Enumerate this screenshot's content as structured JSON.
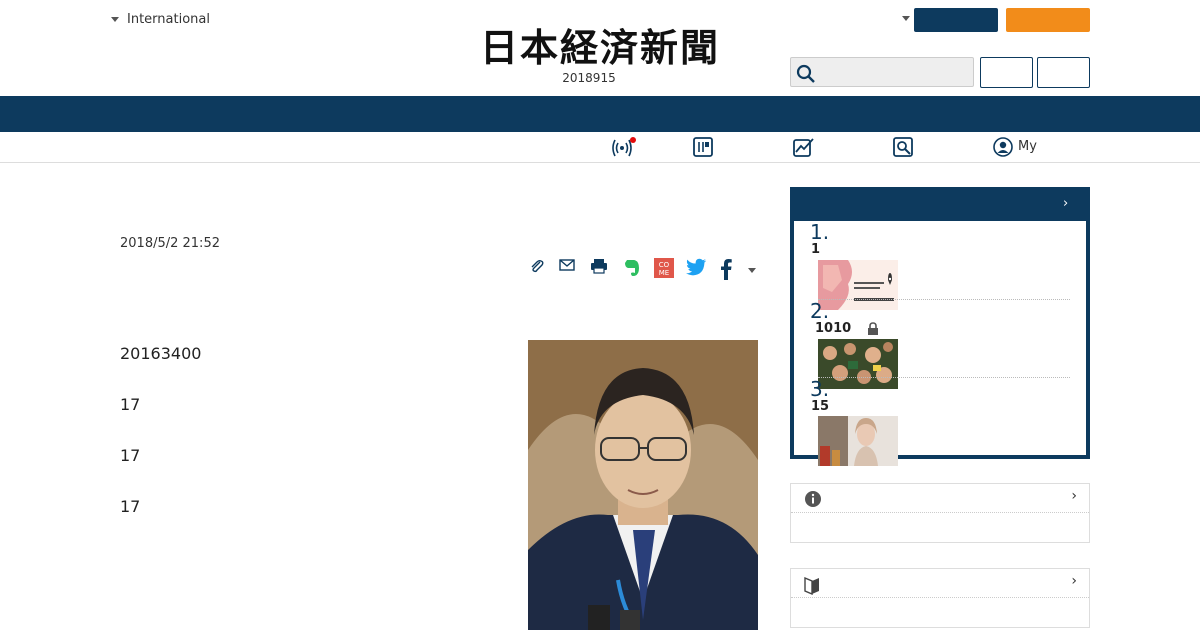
{
  "header": {
    "edition": "International",
    "logo": "日本経済新聞",
    "date": "2018915"
  },
  "nav": {
    "my_label": "My"
  },
  "article": {
    "timestamp": "2018/5/2 21:52",
    "paragraphs": [
      "20163400",
      "17",
      "17",
      "17"
    ]
  },
  "ranking": {
    "items": [
      {
        "rank": "1.",
        "title": "1"
      },
      {
        "rank": "2.",
        "title": "1010"
      },
      {
        "rank": "3.",
        "title": "15"
      }
    ]
  },
  "colors": {
    "navy": "#0d3a5e",
    "orange": "#f28c1a"
  }
}
